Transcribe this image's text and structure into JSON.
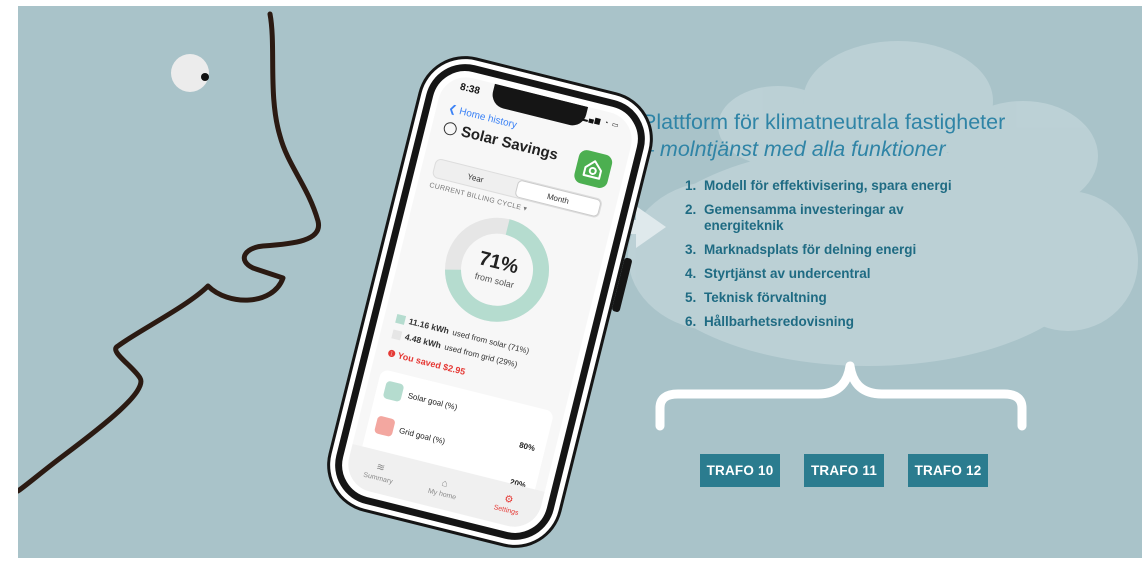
{
  "slide": {
    "heading_line1": "Plattform för klimatneutrala fastigheter",
    "heading_line2": "– molntjänst med alla funktioner",
    "features": [
      {
        "num": "1.",
        "text": "Modell för effektivisering, spara energi"
      },
      {
        "num": "2.",
        "text": "Gemensamma investeringar av energiteknik"
      },
      {
        "num": "3.",
        "text": "Marknadsplats för delning energi"
      },
      {
        "num": "4.",
        "text": "Styrtjänst av undercentral"
      },
      {
        "num": "5.",
        "text": "Teknisk förvaltning"
      },
      {
        "num": "6.",
        "text": "Hållbarhetsredovisning"
      }
    ],
    "trafos": [
      "TRAFO 10",
      "TRAFO 11",
      "TRAFO 12"
    ],
    "colors": {
      "background": "#a9c3c9",
      "heading": "#2f84a6",
      "list": "#1f6b83",
      "trafo": "#2b7c8f"
    }
  },
  "phone": {
    "status_time": "8:38",
    "back_link": "Home history",
    "app_title": "Solar Savings",
    "segments": {
      "year": "Year",
      "month": "Month",
      "selected": "Month"
    },
    "billing_cycle": "CURRENT BILLING CYCLE",
    "donut": {
      "percent_label": "71%",
      "sub_label": "from solar",
      "solar_fraction": 0.71
    },
    "legend": [
      {
        "value": "11.16 kWh",
        "text": "used from solar (71%)",
        "color": "#b5dccf"
      },
      {
        "value": "4.48 kWh",
        "text": "used from grid (29%)",
        "color": "#e6e6e6"
      }
    ],
    "saved": "You saved $2.95",
    "goals": [
      {
        "label": "Solar goal (%)",
        "value": "80%",
        "icon": "sun-icon",
        "color": "#b5dccf"
      },
      {
        "label": "Grid goal (%)",
        "value": "20%",
        "icon": "plug-icon",
        "color": "#f3a7a0"
      }
    ],
    "tabs": [
      {
        "label": "Summary",
        "icon": "layers-icon"
      },
      {
        "label": "My home",
        "icon": "home-icon"
      },
      {
        "label": "Settings",
        "icon": "gears-icon"
      }
    ],
    "active_tab": "Settings"
  }
}
